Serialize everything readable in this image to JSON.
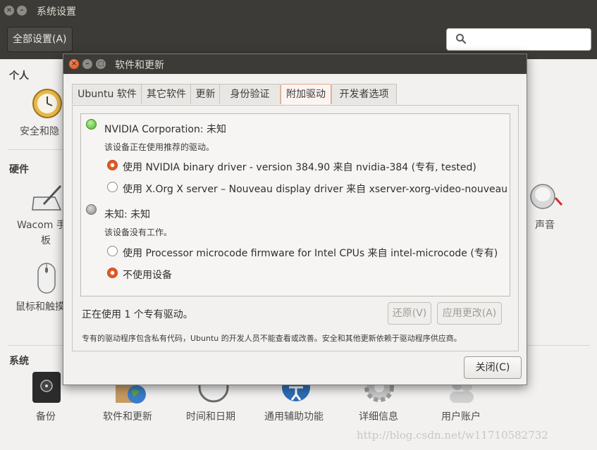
{
  "background_window": {
    "title": "系统设置",
    "all_settings_button": "全部设置(A)",
    "search_placeholder": "",
    "sections": {
      "personal": "个人",
      "hardware": "硬件",
      "system": "系统"
    },
    "personal_items": [
      "安全和隐"
    ],
    "hardware_items_left": [
      "Wacom 手",
      "板",
      "鼠标和触摸"
    ],
    "hardware_items_right": [
      "声音"
    ],
    "system_items": [
      "备份",
      "软件和更新",
      "时间和日期",
      "通用辅助功能",
      "详细信息",
      "用户账户"
    ]
  },
  "dialog": {
    "title": "软件和更新",
    "tabs": [
      "Ubuntu 软件",
      "其它软件",
      "更新",
      "身份验证",
      "附加驱动",
      "开发者选项"
    ],
    "active_tab": "附加驱动",
    "devices": [
      {
        "title": "NVIDIA Corporation: 未知",
        "status": "该设备正在使用推荐的驱动。",
        "led": "green",
        "options": [
          {
            "label": "使用 NVIDIA binary driver - version 384.90 来自 nvidia-384 (专有, tested)",
            "selected": true
          },
          {
            "label": "使用 X.Org X server – Nouveau display driver 来自 xserver-xorg-video-nouveau (开",
            "selected": false
          }
        ]
      },
      {
        "title": "未知: 未知",
        "status": "该设备没有工作。",
        "led": "gray",
        "options": [
          {
            "label": "使用 Processor microcode firmware for Intel CPUs 来自 intel-microcode (专有)",
            "selected": false
          },
          {
            "label": "不使用设备",
            "selected": true
          }
        ]
      }
    ],
    "status_line": "正在使用 1 个专有驱动。",
    "revert_button": "还原(V)",
    "apply_button": "应用更改(A)",
    "footnote": "专有的驱动程序包含私有代码，Ubuntu 的开发人员不能查看或改善。安全和其他更新依赖于驱动程序供应商。",
    "close_button": "关闭(C)"
  },
  "watermark": "http://blog.csdn.net/w11710582732",
  "colors": {
    "titlebar": "#3c3b37",
    "accent": "#e05a24",
    "window_bg": "#f2f1f0"
  }
}
